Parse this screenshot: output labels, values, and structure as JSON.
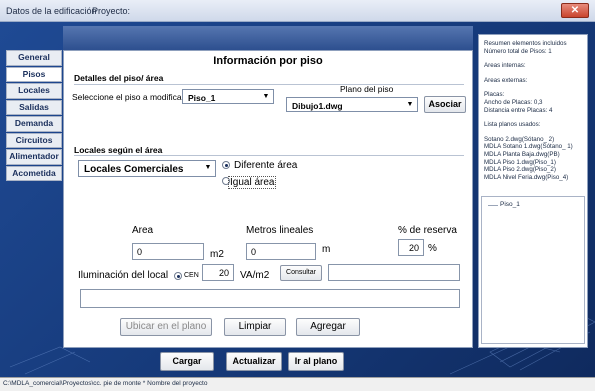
{
  "window": {
    "title": "Datos de la edificación",
    "title2": "Proyecto:",
    "close_glyph": "✕"
  },
  "sidebar": {
    "items": [
      {
        "label": "General"
      },
      {
        "label": "Pisos"
      },
      {
        "label": "Locales"
      },
      {
        "label": "Salidas"
      },
      {
        "label": "Demanda"
      },
      {
        "label": "Circuitos"
      },
      {
        "label": "Alimentador"
      },
      {
        "label": "Acometida"
      }
    ]
  },
  "panel": {
    "title": "Información por piso",
    "details_heading": "Detalles del piso/ área",
    "select_floor_label": "Seleccione el piso a modificar",
    "floor_value": "Piso_1",
    "plan_label": "Plano del piso",
    "plan_value": "Dibujo1.dwg",
    "associate_button": "Asociar",
    "locales_heading": "Locales según el área",
    "locales_value": "Locales Comerciales",
    "radio_different": "Diferente área",
    "radio_equal": "Igual área",
    "area_label": "Area",
    "area_value": "0",
    "area_unit": "m2",
    "meters_label": "Metros lineales",
    "meters_value": "0",
    "meters_unit": "m",
    "reserve_label": "% de reserva",
    "reserve_value": "20",
    "reserve_unit": "%",
    "lighting_label": "Iluminación del local",
    "lighting_radio": "CEN",
    "lighting_value": "20",
    "lighting_unit": "VA/m2",
    "consult_button": "Consultar",
    "consult_value": "",
    "notes_value": "",
    "locate_button": "Ubicar en el plano",
    "clear_button": "Limpiar",
    "add_button": "Agregar"
  },
  "summary": {
    "lines": [
      "Resumen elementos incluidos",
      "Número total de Pisos: 1",
      "",
      "Areas internas:",
      "",
      "Areas externas:",
      "",
      "Placas:",
      "Ancho de Placas: 0,3",
      "Distancia entre Placas: 4",
      "",
      "Lista planos usados:",
      "",
      "Sotano 2.dwg(Sótano_ 2)",
      "MDLA Sotano 1.dwg(Sótano_ 1)",
      "MDLA Planta Baja.dwg(PB)",
      "MDLA Piso 1.dwg(Piso_1)",
      "MDLA Piso 2.dwg(Piso_2)",
      "MDLA Nivel Feria.dwg(Piso_4)"
    ],
    "tree_item": "Piso_1"
  },
  "bottom": {
    "load_button": "Cargar",
    "update_button": "Actualizar",
    "goto_plan_button": "Ir al plano"
  },
  "status": {
    "path": "C:\\MDLA_comercial\\Proyectos\\cc. pie de monte * Nombre del proyecto"
  },
  "colors": {
    "accent": "#1a3d7c",
    "close": "#c9452e"
  }
}
